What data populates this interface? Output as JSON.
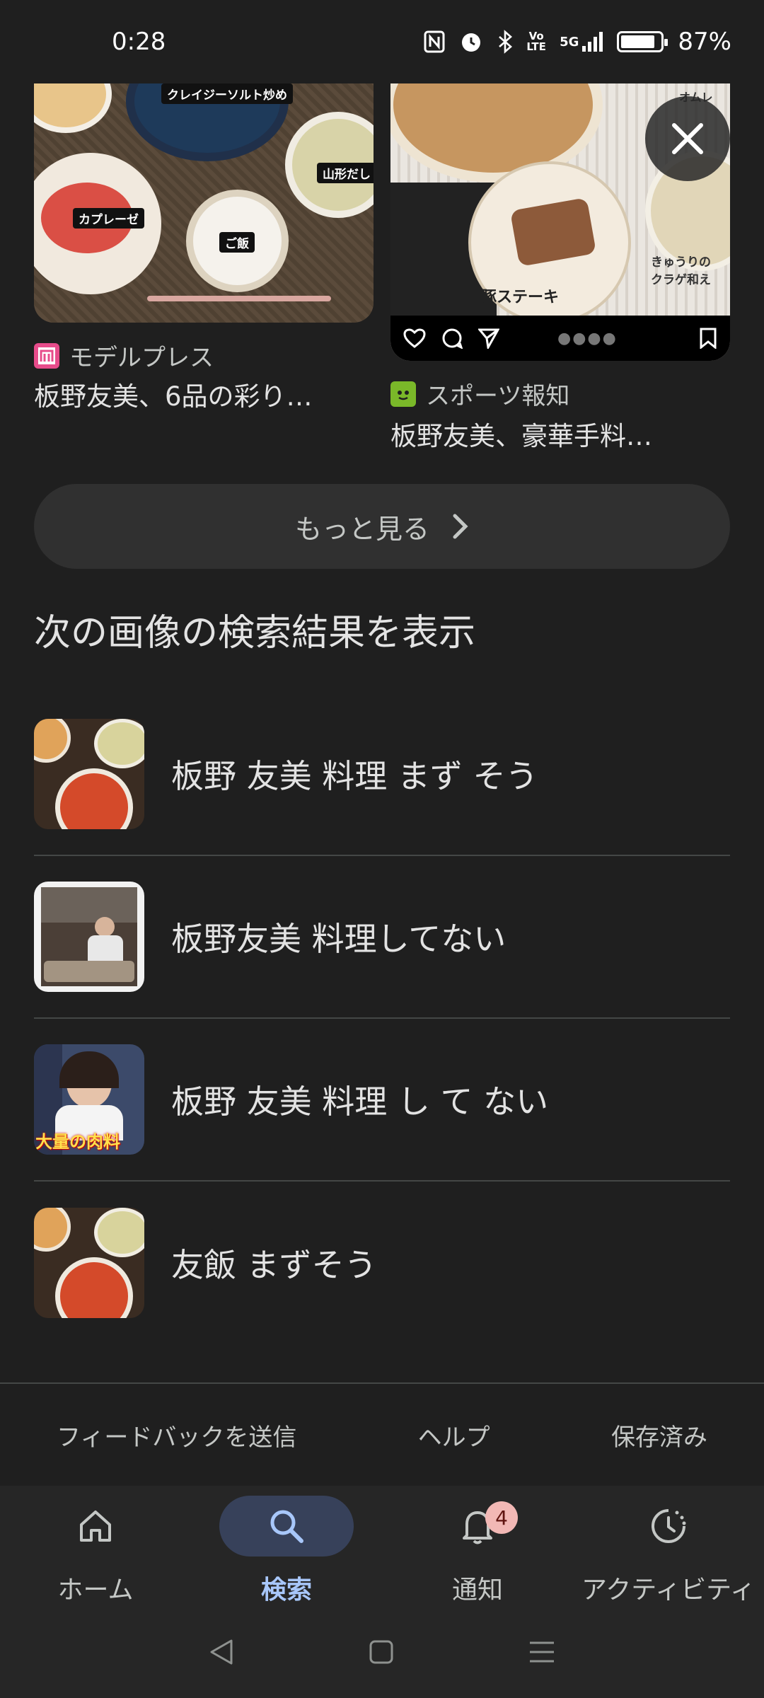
{
  "status_bar": {
    "time": "0:28",
    "battery": "87%",
    "battery_level": 0.87,
    "icons": [
      "nfc-icon",
      "alarm-icon",
      "bluetooth-icon",
      "volte-icon",
      "signal-5g-icon",
      "battery-icon"
    ],
    "volte_text": "Vo LTE",
    "net_text": "5G"
  },
  "cards": [
    {
      "source": "モデルプレス",
      "title": "板野友美、6品の彩り…",
      "favicon_color": "#e74c8b",
      "image_labels": [
        "クレイジーソルト炒め",
        "カプレーゼ",
        "山形だし",
        "ご飯"
      ]
    },
    {
      "source": "スポーツ報知",
      "title": "板野友美、豪華手料…",
      "favicon_color": "#7ab829",
      "image_labels": [
        "豚ステーキ",
        "きゅうりの クラゲ和え",
        "オムレ"
      ]
    }
  ],
  "more_button": {
    "label": "もっと見る"
  },
  "related": {
    "heading": "次の画像の検索結果を表示",
    "items": [
      {
        "label": "板野 友美 料理 まず そう"
      },
      {
        "label": "板野友美 料理してない"
      },
      {
        "label": "板野 友美 料理 し て ない",
        "thumb_text": "大量の肉料"
      },
      {
        "label": "友飯 まずそう"
      }
    ]
  },
  "footer": {
    "feedback": "フィードバックを送信",
    "help": "ヘルプ",
    "saved": "保存済み"
  },
  "bottom_nav": {
    "items": [
      {
        "label": "ホーム",
        "icon": "home-icon"
      },
      {
        "label": "検索",
        "icon": "search-icon",
        "active": true
      },
      {
        "label": "通知",
        "icon": "bell-icon",
        "badge": "4"
      },
      {
        "label": "アクティビティ",
        "icon": "activity-icon"
      }
    ]
  },
  "colors": {
    "background": "#1f1f1f",
    "accent": "#a8c7fa",
    "active_pill": "#37415a",
    "badge": "#f2b8b5"
  }
}
